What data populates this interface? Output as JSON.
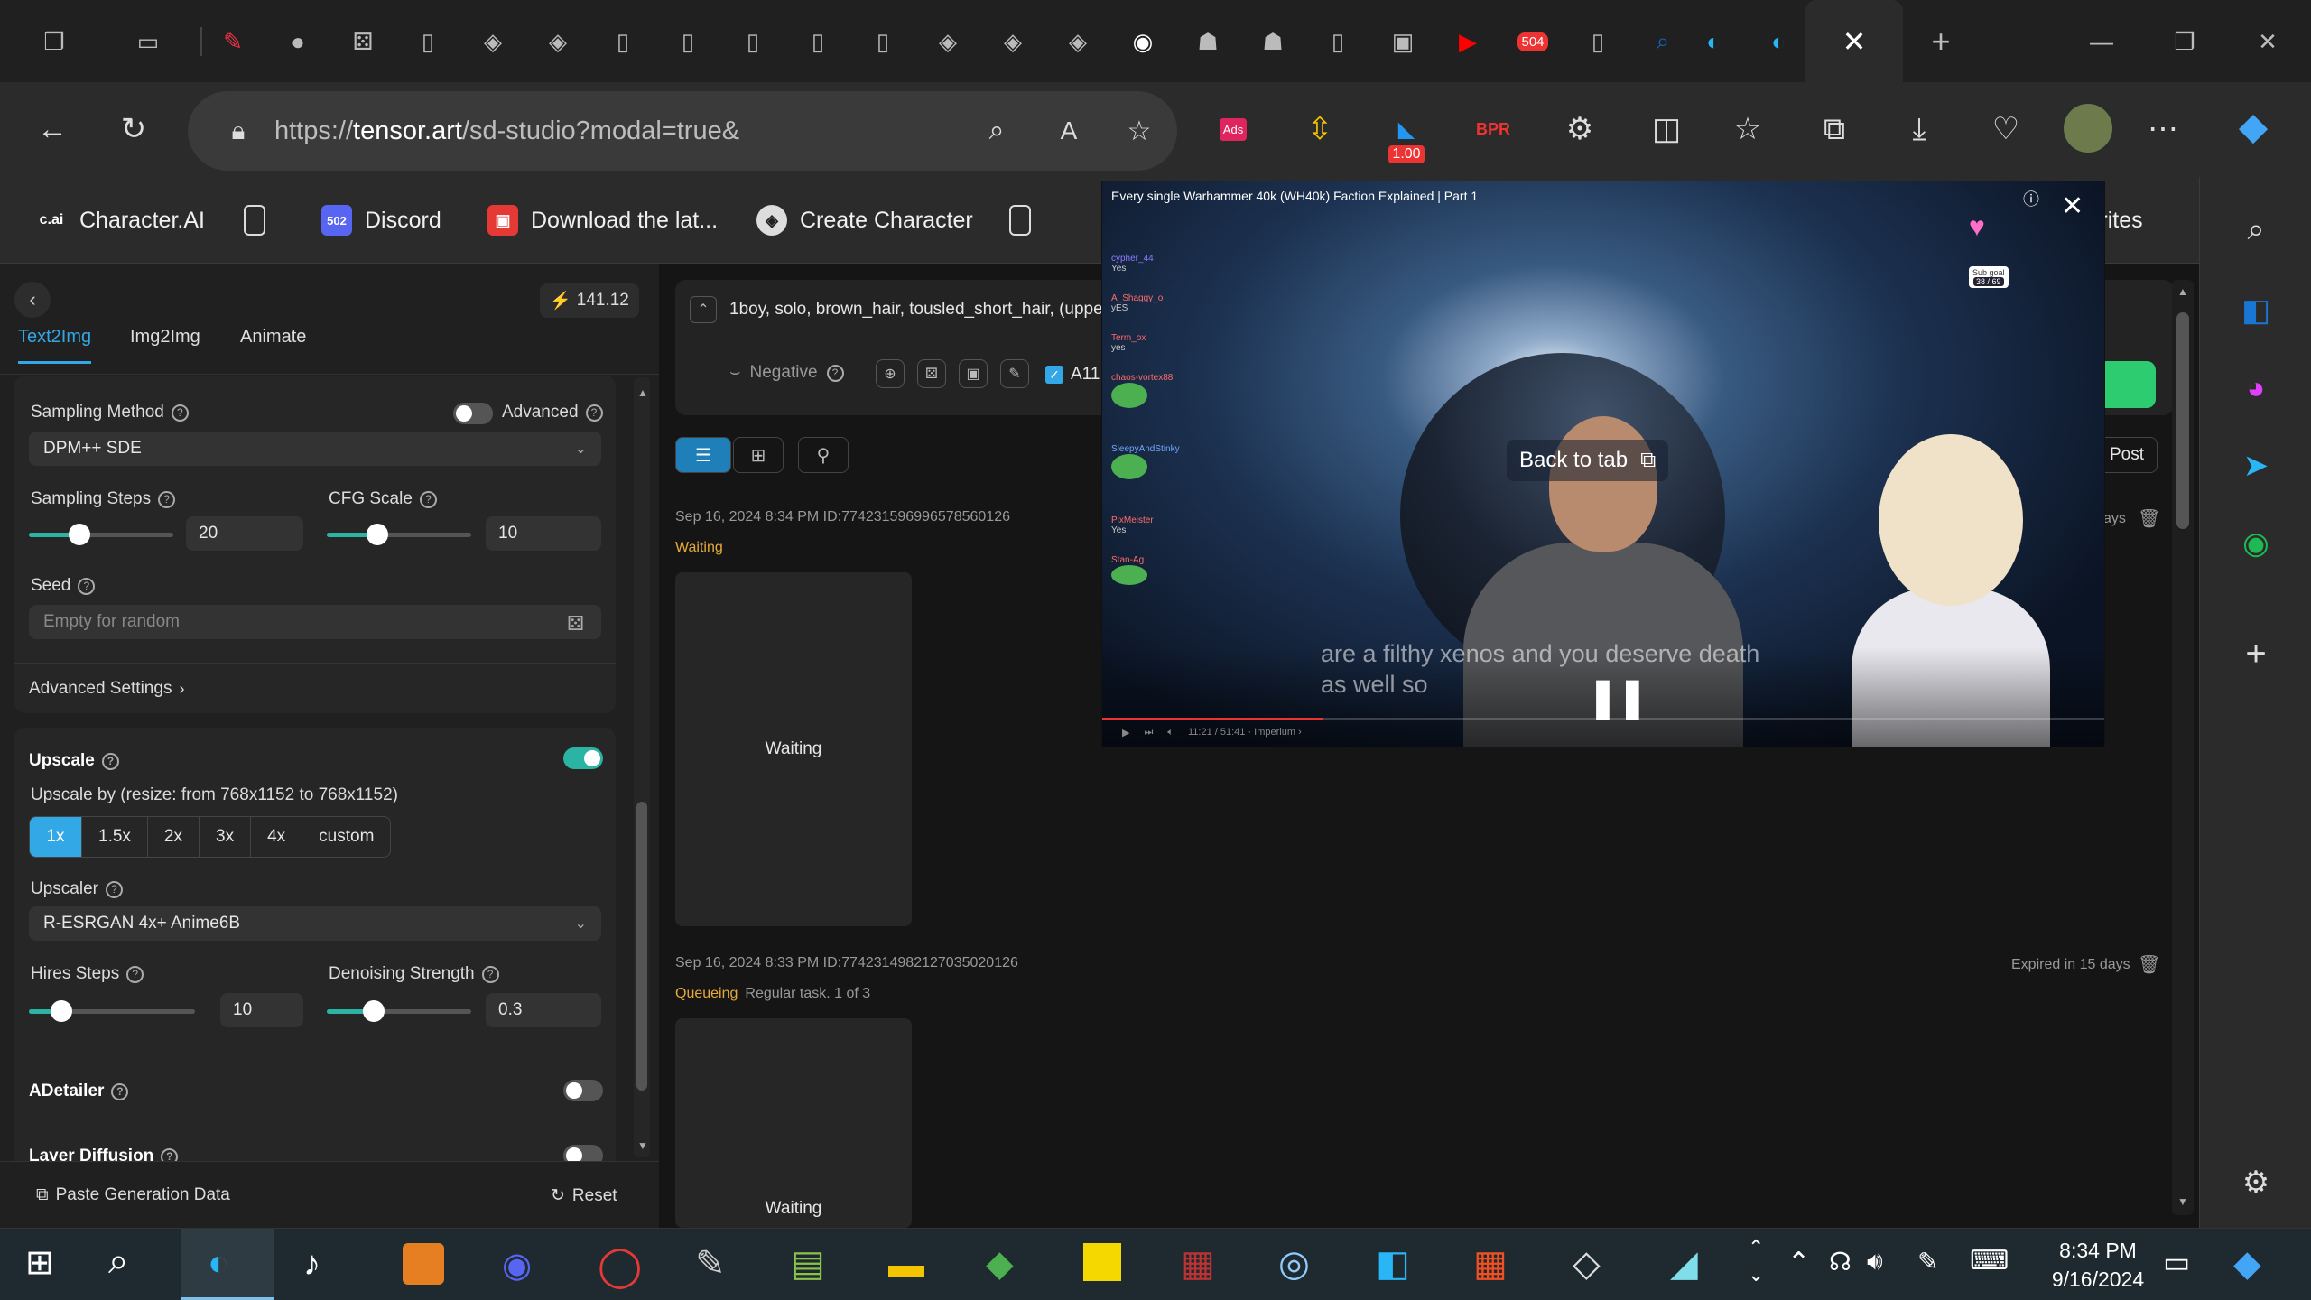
{
  "browser": {
    "url_prefix": "https://",
    "url_domain": "tensor.art",
    "url_path": "/sd-studio?modal=true&",
    "tab_badges": {
      "tab_504": "504"
    },
    "ext_badge": "1.00",
    "ext_text": "BPR",
    "ads_text": "Ads"
  },
  "favorites": [
    {
      "label": "Character.AI",
      "icon_text": "c.ai"
    },
    {
      "label": "",
      "icon_text": ""
    },
    {
      "label": "Discord",
      "icon_text": "502"
    },
    {
      "label": "Download the lat...",
      "icon_text": ""
    },
    {
      "label": "Create Character",
      "icon_text": ""
    },
    {
      "label": "",
      "icon_text": ""
    }
  ],
  "favorites_overflow": "vorites",
  "left": {
    "credits": "141.12",
    "tabs": [
      "Text2Img",
      "Img2Img",
      "Animate"
    ],
    "sampling_method_label": "Sampling Method",
    "advanced_label": "Advanced",
    "sampling_method": "DPM++ SDE",
    "sampling_steps_label": "Sampling Steps",
    "sampling_steps": "20",
    "cfg_label": "CFG Scale",
    "cfg": "10",
    "seed_label": "Seed",
    "seed_placeholder": "Empty for random",
    "advanced_settings": "Advanced Settings",
    "upscale_title": "Upscale",
    "upscale_desc": "Upscale by (resize: from 768x1152 to 768x1152)",
    "upscale_options": [
      "1x",
      "1.5x",
      "2x",
      "3x",
      "4x",
      "custom"
    ],
    "upscaler_label": "Upscaler",
    "upscaler": "R-ESRGAN 4x+ Anime6B",
    "hires_label": "Hires Steps",
    "hires": "10",
    "denoise_label": "Denoising Strength",
    "denoise": "0.3",
    "adetailer": "ADetailer",
    "layer_diffusion": "Layer Diffusion",
    "paste": "Paste Generation Data",
    "reset": "Reset"
  },
  "main": {
    "prompt": "1boy, solo, brown_hair, tousled_short_hair, (upper_",
    "negative": "Negative",
    "checkbox_label": "A11",
    "post": "Post",
    "jobs": [
      {
        "meta": "Sep 16, 2024 8:34 PM ID:774231596996578560126",
        "status": "Waiting",
        "extra": "",
        "placeholder": "Waiting",
        "expires": "ays"
      },
      {
        "meta": "Sep 16, 2024 8:33 PM ID:774231498212703502012​6",
        "status": "Queueing",
        "extra": "Regular task. 1 of 3",
        "placeholder": "Waiting",
        "expires": "Expired in 15 days"
      }
    ]
  },
  "pip": {
    "title": "Every single Warhammer 40k (WH40k) Faction Explained | Part 1",
    "back_to_tab": "Back to tab",
    "subtitle_1": "are a filthy xenos and you deserve death",
    "subtitle_2": "as well so",
    "time": "11:21 / 51:41 · Imperium ›",
    "sub_goal": "Sub goal",
    "sub_count": "38 / 69",
    "chat": [
      {
        "user": "cypher_44",
        "msg": "Yes"
      },
      {
        "user": "A_Shaggy_o",
        "msg": "yES"
      },
      {
        "user": "Term_ox",
        "msg": "yes"
      },
      {
        "user": "chaos-vortex88",
        "msg": ""
      },
      {
        "user": "SleepyAndStinky",
        "msg": ""
      },
      {
        "user": "PixMeister",
        "msg": "Yes"
      },
      {
        "user": "Stan-Ag",
        "msg": ""
      }
    ]
  },
  "taskbar": {
    "time": "8:34 PM",
    "date": "9/16/2024"
  },
  "colors": {
    "accent": "#33a8e6",
    "toggle_on": "#2bb3a3",
    "waiting": "#e6a93b"
  }
}
